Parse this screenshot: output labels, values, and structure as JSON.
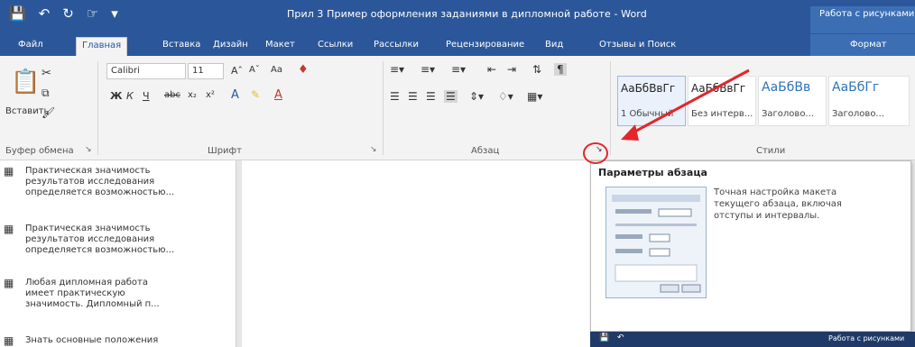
{
  "titlebar": {
    "qat_icons": [
      "save-icon",
      "undo-icon",
      "redo-icon",
      "touch-mode-icon",
      "customize-icon"
    ],
    "document_title": "Прил 3 Пример оформления заданиями в дипломной работе - Word",
    "context_title": "Работа с рисунками"
  },
  "tabs": [
    {
      "label": "Файл"
    },
    {
      "label": "Главная"
    },
    {
      "label": "Вставка"
    },
    {
      "label": "Дизайн"
    },
    {
      "label": "Макет"
    },
    {
      "label": "Ссылки"
    },
    {
      "label": "Рассылки"
    },
    {
      "label": "Рецензирование"
    },
    {
      "label": "Вид"
    },
    {
      "label": "Отзывы и Поиск"
    },
    {
      "label": "Формат"
    }
  ],
  "ribbon": {
    "clipboard": {
      "paste_label": "Вставить",
      "group_label": "Буфер обмена"
    },
    "font": {
      "font_name": "Calibri",
      "font_size": "11",
      "case_label": "Aa",
      "bold": "Ж",
      "italic": "К",
      "underline": "Ч",
      "strike": "abc",
      "sub": "x₂",
      "sup": "x²",
      "group_label": "Шрифт"
    },
    "paragraph": {
      "group_label": "Абзац"
    },
    "styles": {
      "group_label": "Стили",
      "items": [
        {
          "sample": "АаБбВвГг",
          "name": "1 Обычный"
        },
        {
          "sample": "АаБбВвГг",
          "name": "Без интерв..."
        },
        {
          "sample": "АаБбВв",
          "name": "Заголово..."
        },
        {
          "sample": "АаБбГг",
          "name": "Заголово..."
        }
      ]
    }
  },
  "navpane": {
    "items": [
      {
        "text": "Практическая значимость\nрезультатов исследования\nопределяется возможностью..."
      },
      {
        "text": "Практическая значимость\nрезультатов исследования\nопределяется возможностью..."
      },
      {
        "text": "Любая дипломная работа\nимеет практическую\nзначимость. Дипломный п..."
      },
      {
        "text": "Знать основные положения"
      }
    ]
  },
  "tooltip": {
    "title": "Параметры абзаца",
    "body": "Точная настройка макета\nтекущего абзаца, включая\nотступы и интервалы."
  },
  "taskbar": {
    "right_text": "Работа с рисунками"
  },
  "colors": {
    "word_blue": "#2b579a",
    "annotation_red": "#e3262b"
  }
}
